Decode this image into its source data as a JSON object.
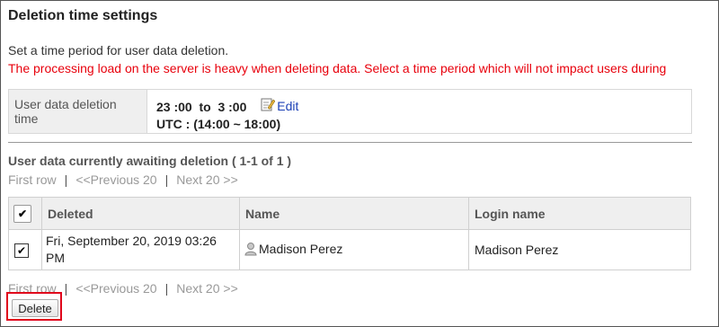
{
  "page": {
    "title": "Deletion time settings",
    "description": "Set a time period for user data deletion.",
    "warning": "The processing load on the server is heavy when deleting data. Select a time period which will not impact users during"
  },
  "settings": {
    "label": "User data deletion time",
    "time_range": "23 :00  to  3 :00",
    "edit_label": "Edit",
    "utc": "UTC : (14:00 ~ 18:00)"
  },
  "awaiting": {
    "title": "User data currently awaiting deletion ( 1-1 of 1 )"
  },
  "pager": {
    "first": "First row",
    "prev": "<<Previous 20",
    "next": "Next 20 >>",
    "sep": "|"
  },
  "table": {
    "headers": {
      "deleted": "Deleted",
      "name": "Name",
      "login": "Login name"
    },
    "rows": [
      {
        "checked": true,
        "deleted": "Fri, September 20, 2019 03:26 PM",
        "name": "Madison Perez",
        "login": "Madison Perez"
      }
    ]
  },
  "actions": {
    "delete_label": "Delete"
  },
  "colors": {
    "warning": "#e8000c",
    "link": "#1a3fb5",
    "highlight": "#e0001b"
  },
  "icons": {
    "edit": "edit-pencil-icon",
    "user": "user-icon",
    "check": "checkmark-icon"
  }
}
